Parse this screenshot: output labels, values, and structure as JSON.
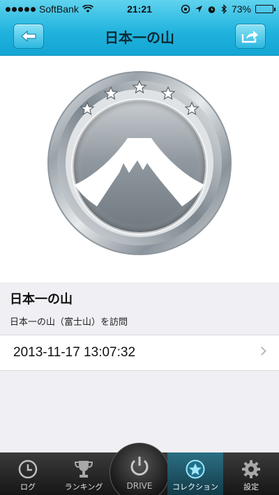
{
  "status_bar": {
    "carrier": "SoftBank",
    "time": "21:21",
    "battery": "73%",
    "battery_level": 0.73,
    "signal_icon": "signal-dots-icon",
    "wifi_icon": "wifi-icon",
    "bluetooth_icon": "bluetooth-icon"
  },
  "nav": {
    "title": "日本一の山",
    "back_icon": "back-arrow-icon",
    "share_icon": "share-icon"
  },
  "medal": {
    "icon": "mount-fuji-medal-icon",
    "stars": 5
  },
  "badge": {
    "title": "日本一の山",
    "description": "日本一の山（富士山）を訪問"
  },
  "visit": {
    "datetime": "2013-11-17 13:07:32"
  },
  "tabbar": {
    "tabs": [
      {
        "label": "ログ",
        "icon": "clock-icon"
      },
      {
        "label": "ランキング",
        "icon": "trophy-icon"
      },
      {
        "label": "DRIVE",
        "icon": "power-icon"
      },
      {
        "label": "コレクション",
        "icon": "star-circle-icon",
        "active": true
      },
      {
        "label": "設定",
        "icon": "gear-icon"
      }
    ]
  },
  "colors": {
    "header": "#1fb2dd",
    "tabbar": "#1e1e1e",
    "active_tab": "#1e5566"
  }
}
